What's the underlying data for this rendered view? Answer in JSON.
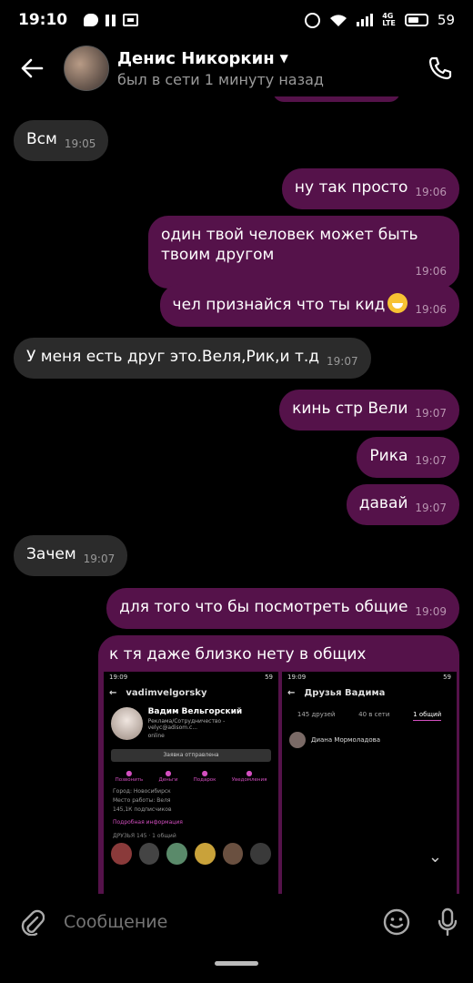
{
  "status_bar": {
    "time": "19:10",
    "network": "4G\nLTE",
    "battery": "59"
  },
  "header": {
    "contact_name": "Денис Никоркин",
    "last_seen": "был в сети 1 минуту назад"
  },
  "messages": [
    {
      "dir": "in",
      "text": "Всм",
      "time": "19:05"
    },
    {
      "dir": "out",
      "text": "ну так просто",
      "time": "19:06"
    },
    {
      "dir": "out",
      "text": "один твой человек может быть твоим другом",
      "time": "19:06"
    },
    {
      "dir": "out",
      "text": "чел признайся что ты кид",
      "time": "19:06"
    },
    {
      "dir": "in",
      "text": "У меня есть друг это.Веля,Рик,и т.д",
      "time": "19:07"
    },
    {
      "dir": "out",
      "text": "кинь стр Вели",
      "time": "19:07"
    },
    {
      "dir": "out",
      "text": "Рика",
      "time": "19:07"
    },
    {
      "dir": "out",
      "text": "давай",
      "time": "19:07"
    },
    {
      "dir": "in",
      "text": "Зачем",
      "time": "19:07"
    },
    {
      "dir": "out",
      "text": "для того что бы посмотреть общие",
      "time": "19:09"
    },
    {
      "dir": "out",
      "text": "к тя даже близко нету в общих",
      "time": ""
    }
  ],
  "attachment": {
    "left": {
      "status_time": "19:09",
      "username": "vadimvelgorsky",
      "profile_name": "Вадим Вельгорский",
      "profile_sub": "Реклама/Сотрудничество - velyc@adisom.c...",
      "online": "online",
      "request_button": "Заявка отправлена",
      "actions": [
        "Позвонить",
        "Деньги",
        "Подарок",
        "Уведомления"
      ],
      "info": [
        "Город: Новосибирск",
        "Место работы: Веля",
        "145,1К подписчиков"
      ],
      "more_info": "Подробная информация",
      "friends_label": "ДРУЗЬЯ 145 · 1 общий"
    },
    "right": {
      "status_time": "19:09",
      "title": "Друзья Вадима",
      "tabs": [
        "145 друзей",
        "40 в сети",
        "1 общий"
      ],
      "friend": "Диана Мормоладова"
    }
  },
  "input": {
    "placeholder": "Сообщение"
  },
  "colors": {
    "outgoing": "#55124a",
    "incoming": "#2b2b2b",
    "accent": "#d34fc0"
  }
}
